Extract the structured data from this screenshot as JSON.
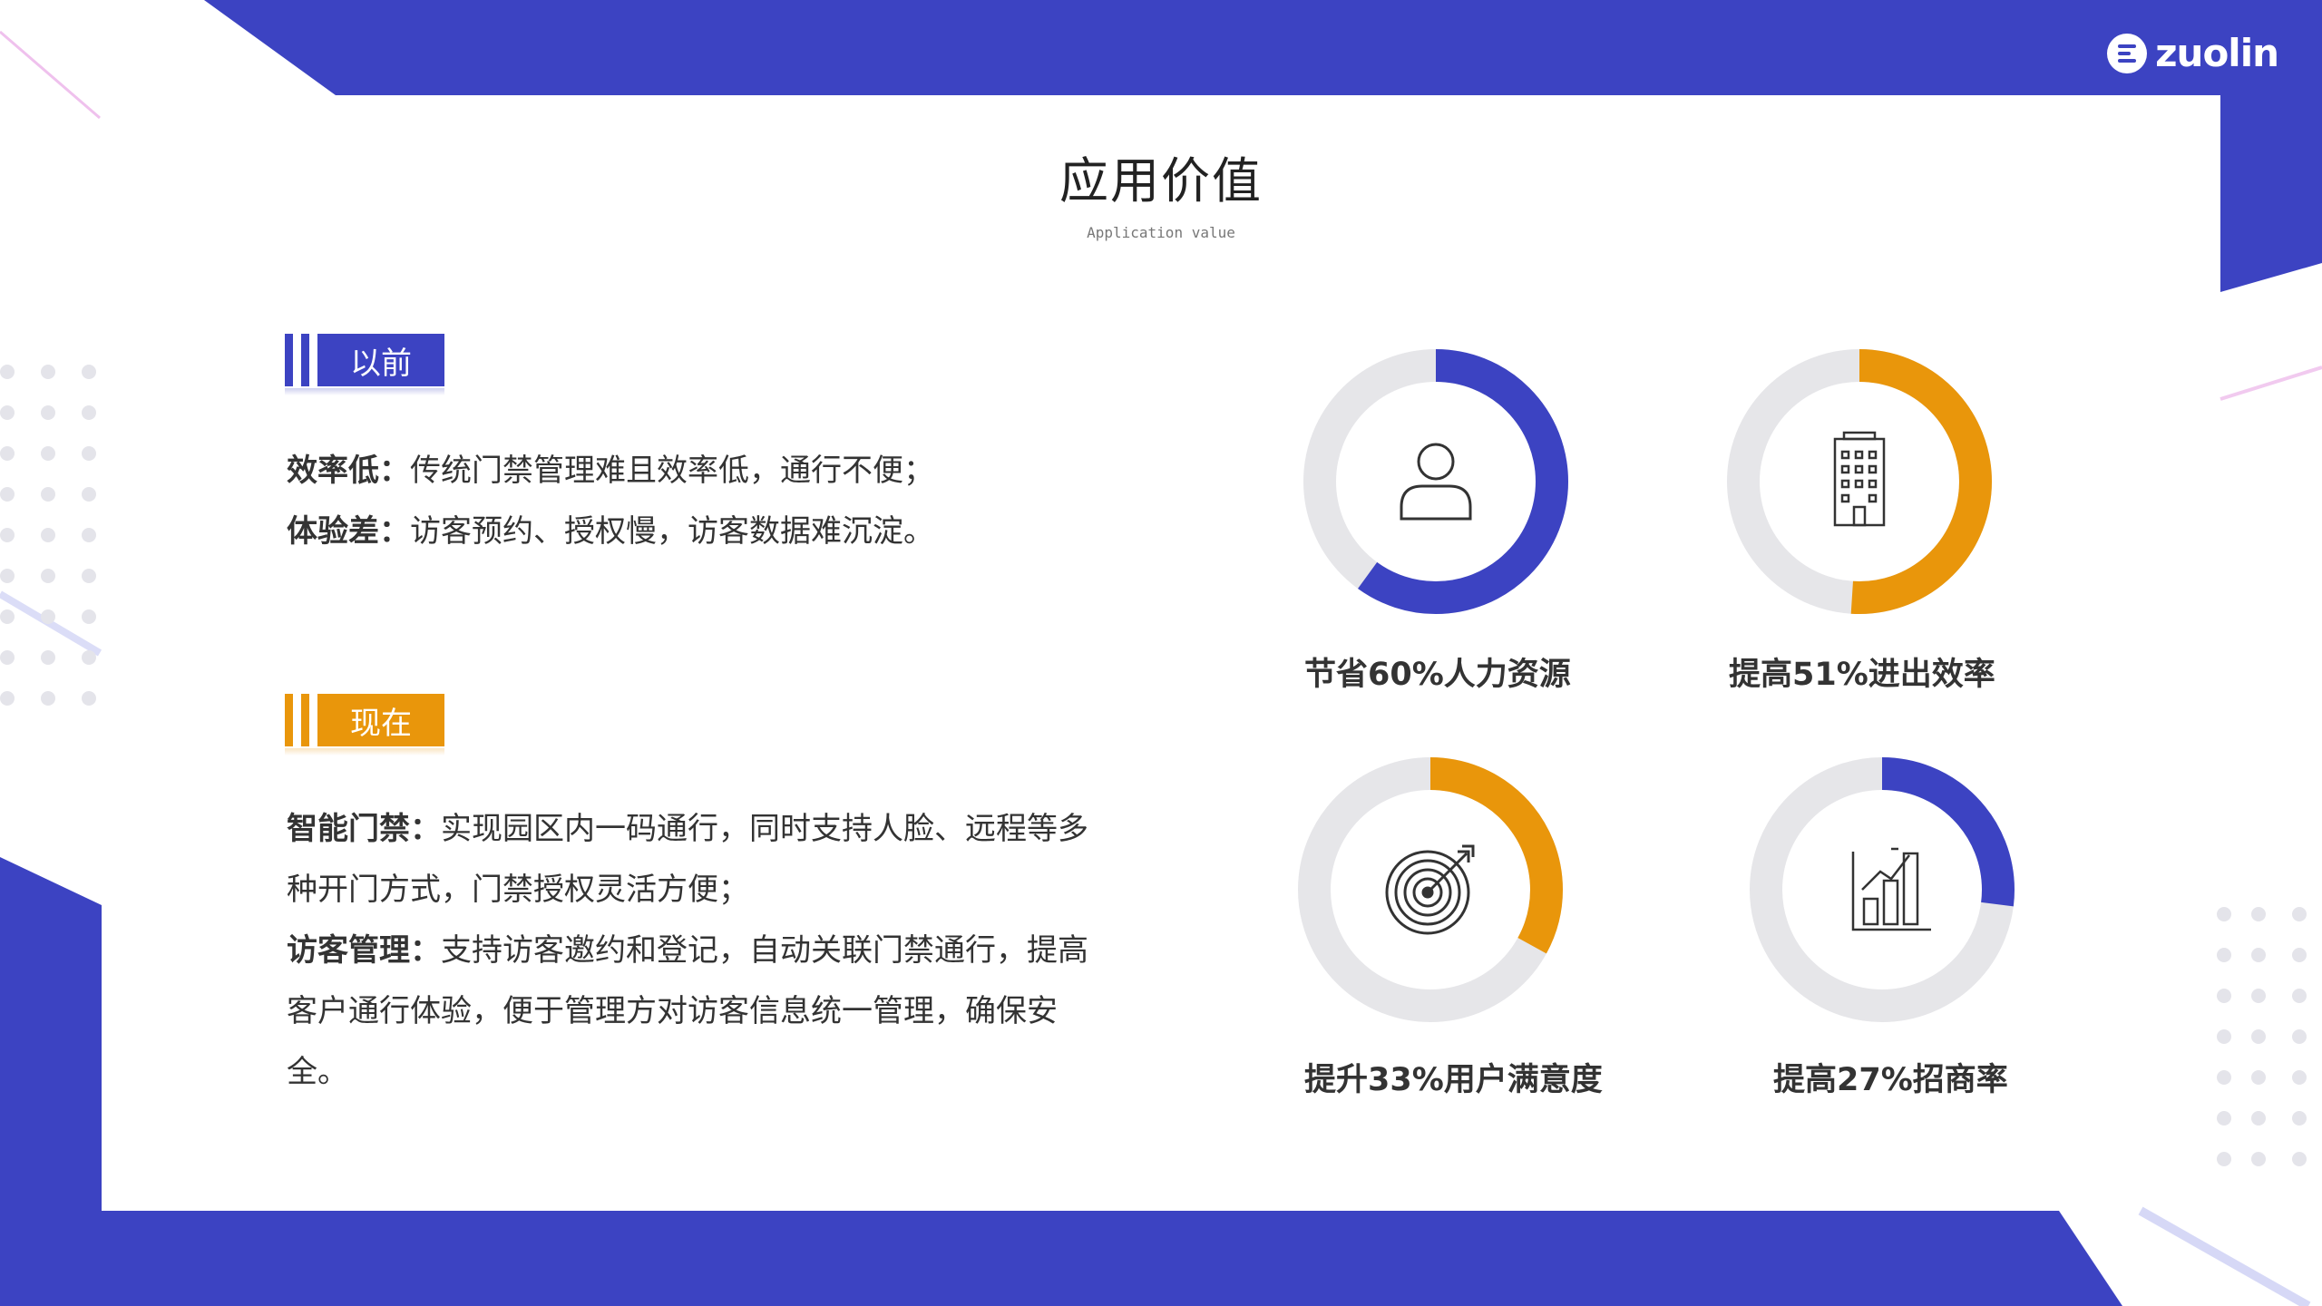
{
  "brand": {
    "name": "zuolin",
    "primary_color": "#3c43c2",
    "accent_color": "#e9960b"
  },
  "page": {
    "title": "应用价值",
    "subtitle": "Application value"
  },
  "before": {
    "tag": "以前",
    "items": [
      {
        "key": "效率低：",
        "text": "传统门禁管理难且效率低，通行不便；"
      },
      {
        "key": "体验差：",
        "text": "访客预约、授权慢，访客数据难沉淀。"
      }
    ]
  },
  "now": {
    "tag": "现在",
    "items": [
      {
        "key": "智能门禁：",
        "text": "实现园区内一码通行，同时支持人脸、远程等多种开门方式，门禁授权灵活方便；"
      },
      {
        "key": "访客管理：",
        "text": "支持访客邀约和登记，自动关联门禁通行，提高客户通行体验，便于管理方对访客信息统一管理，确保安全。"
      }
    ]
  },
  "stats": [
    {
      "label": "节省60%人力资源",
      "value": 60,
      "color": "#3c43c2",
      "icon": "user-icon"
    },
    {
      "label": "提高51%进出效率",
      "value": 51,
      "color": "#e9960b",
      "icon": "building-icon"
    },
    {
      "label": "提升33%用户满意度",
      "value": 33,
      "color": "#e9960b",
      "icon": "target-icon"
    },
    {
      "label": "提高27%招商率",
      "value": 27,
      "color": "#3c43c2",
      "icon": "growth-chart-icon"
    }
  ]
}
